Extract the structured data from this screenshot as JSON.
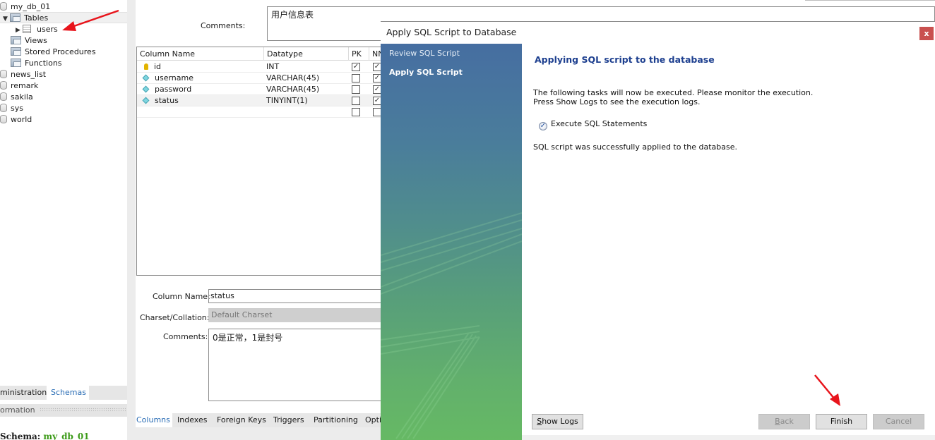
{
  "navigator": {
    "tree": [
      {
        "label": "my_db_01",
        "type": "schema",
        "icon": "database-icon"
      },
      {
        "label": "Tables",
        "type": "folder",
        "icon": "tables-folder-icon",
        "expanded": true
      },
      {
        "label": "users",
        "type": "table",
        "icon": "table-icon"
      },
      {
        "label": "Views",
        "type": "folder",
        "icon": "views-folder-icon"
      },
      {
        "label": "Stored Procedures",
        "type": "folder",
        "icon": "procedures-folder-icon"
      },
      {
        "label": "Functions",
        "type": "folder",
        "icon": "functions-folder-icon"
      },
      {
        "label": "news_list",
        "type": "schema",
        "icon": "database-icon"
      },
      {
        "label": "remark",
        "type": "schema",
        "icon": "database-icon"
      },
      {
        "label": "sakila",
        "type": "schema",
        "icon": "database-icon"
      },
      {
        "label": "sys",
        "type": "schema",
        "icon": "database-icon"
      },
      {
        "label": "world",
        "type": "schema",
        "icon": "database-icon"
      }
    ],
    "tabs": [
      {
        "label": "ministration",
        "active": false
      },
      {
        "label": "Schemas",
        "active": true
      }
    ],
    "info_label": "ormation",
    "schema_label": "Schema:",
    "schema_value": "my_db_01"
  },
  "editor": {
    "table_comments_label": "Comments:",
    "table_comments_value": "用户信息表",
    "grid": {
      "headers": [
        "Column Name",
        "Datatype",
        "PK",
        "NN"
      ],
      "rows": [
        {
          "name": "id",
          "icon": "primary-key-icon",
          "datatype": "INT",
          "pk": true,
          "nn": true
        },
        {
          "name": "username",
          "icon": "column-diamond-icon",
          "datatype": "VARCHAR(45)",
          "pk": false,
          "nn": true
        },
        {
          "name": "password",
          "icon": "column-diamond-icon",
          "datatype": "VARCHAR(45)",
          "pk": false,
          "nn": true
        },
        {
          "name": "status",
          "icon": "column-diamond-icon",
          "datatype": "TINYINT(1)",
          "pk": false,
          "nn": true,
          "selected": true
        },
        {
          "name": "",
          "icon": "",
          "datatype": "",
          "pk": false,
          "nn": false
        }
      ]
    },
    "column_name_label": "Column Name:",
    "column_name_value": "status",
    "charset_label": "Charset/Collation:",
    "charset_value": "Default Charset",
    "column_comments_label": "Comments:",
    "column_comments_value": "0是正常，1是封号",
    "tabs": [
      {
        "label": "Columns",
        "active": true
      },
      {
        "label": "Indexes",
        "active": false
      },
      {
        "label": "Foreign Keys",
        "active": false
      },
      {
        "label": "Triggers",
        "active": false
      },
      {
        "label": "Partitioning",
        "active": false
      },
      {
        "label": "Opti",
        "active": false
      }
    ]
  },
  "dialog": {
    "title": "Apply SQL Script to Database",
    "close_label": "x",
    "steps": [
      {
        "label": "Review SQL Script",
        "active": false
      },
      {
        "label": "Apply SQL Script",
        "active": true
      }
    ],
    "heading": "Applying SQL script to the database",
    "description_line1": "The following tasks will now be executed. Please monitor the execution.",
    "description_line2": "Press Show Logs to see the execution logs.",
    "task": {
      "label": "Execute SQL Statements",
      "status": "done",
      "icon": "check-circle-icon"
    },
    "result_message": "SQL script was successfully applied to the database.",
    "buttons": {
      "show_logs": {
        "mnemonic": "S",
        "rest": "how Logs",
        "enabled": true
      },
      "back": {
        "mnemonic": "B",
        "rest": "ack",
        "enabled": false
      },
      "finish": {
        "label": "Finish",
        "enabled": true
      },
      "cancel": {
        "label": "Cancel",
        "enabled": false
      }
    }
  },
  "annotations": {
    "arrow_color": "#e8141b"
  }
}
